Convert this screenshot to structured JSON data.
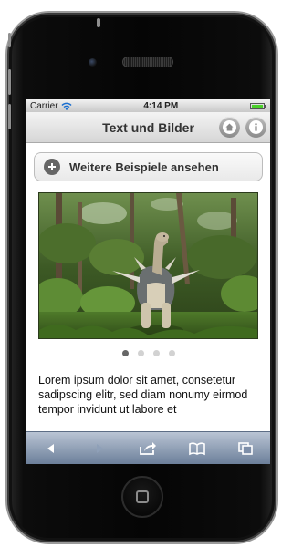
{
  "status_bar": {
    "carrier": "Carrier",
    "time": "4:14 PM",
    "battery_level": 1.0,
    "battery_color": "#4bd12a"
  },
  "header": {
    "title": "Text und Bilder",
    "left_icon": "home-icon",
    "right_icon": "info-icon"
  },
  "content": {
    "more_button_label": "Weitere Beispiele ansehen",
    "more_button_icon": "plus-circle-icon",
    "image_subject": "dinosaur-sculpture-in-forest",
    "pager": {
      "total": 4,
      "active": 1
    },
    "paragraph": "Lorem ipsum dolor sit amet, consetetur sadipscing elitr, sed diam nonumy eirmod tempor invidunt ut labore et"
  },
  "toolbar": {
    "items": [
      "back-arrow-icon",
      "forward-arrow-icon",
      "share-icon",
      "bookmarks-icon",
      "tabs-icon"
    ],
    "forward_enabled": false
  },
  "colors": {
    "toolbar_top": "#b9c4d4",
    "toolbar_bottom": "#6c7f9a",
    "header_text": "#333333"
  }
}
